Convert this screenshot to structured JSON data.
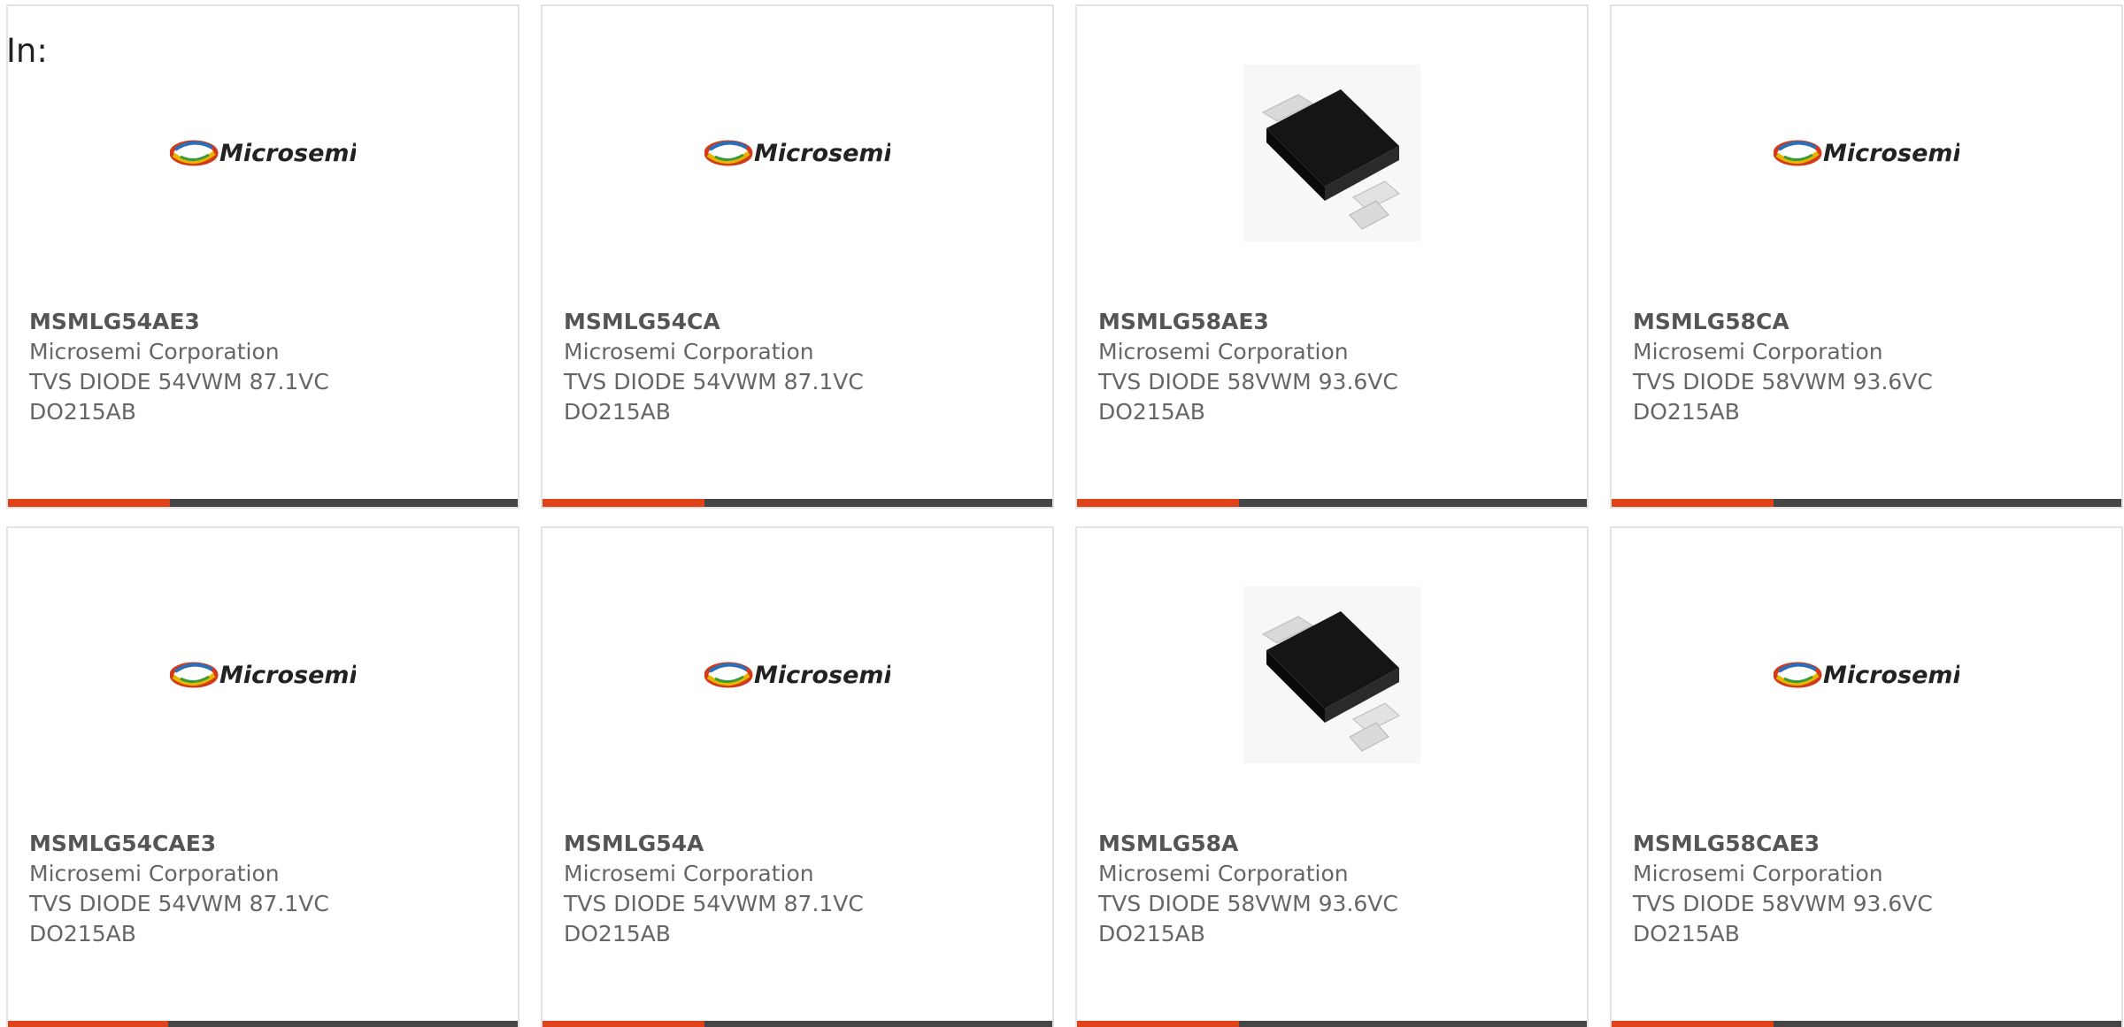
{
  "prefix_label": "In:",
  "colors": {
    "accent": "#e0421a",
    "bar": "#464646",
    "border": "#e3e3e3",
    "text": "#666666"
  },
  "products": [
    {
      "part": "MSMLG54AE3",
      "manufacturer": "Microsemi Corporation",
      "description": "TVS DIODE 54VWM 87.1VC",
      "package": "DO215AB",
      "image": "microsemi-logo",
      "brand_text": "Microsemi"
    },
    {
      "part": "MSMLG54CA",
      "manufacturer": "Microsemi Corporation",
      "description": "TVS DIODE 54VWM 87.1VC",
      "package": "DO215AB",
      "image": "microsemi-logo",
      "brand_text": "Microsemi"
    },
    {
      "part": "MSMLG58AE3",
      "manufacturer": "Microsemi Corporation",
      "description": "TVS DIODE 58VWM 93.6VC",
      "package": "DO215AB",
      "image": "diode-package-photo",
      "brand_text": ""
    },
    {
      "part": "MSMLG58CA",
      "manufacturer": "Microsemi Corporation",
      "description": "TVS DIODE 58VWM 93.6VC",
      "package": "DO215AB",
      "image": "microsemi-logo",
      "brand_text": "Microsemi"
    },
    {
      "part": "MSMLG54CAE3",
      "manufacturer": "Microsemi Corporation",
      "description": "TVS DIODE 54VWM 87.1VC",
      "package": "DO215AB",
      "image": "microsemi-logo",
      "brand_text": "Microsemi"
    },
    {
      "part": "MSMLG54A",
      "manufacturer": "Microsemi Corporation",
      "description": "TVS DIODE 54VWM 87.1VC",
      "package": "DO215AB",
      "image": "microsemi-logo",
      "brand_text": "Microsemi"
    },
    {
      "part": "MSMLG58A",
      "manufacturer": "Microsemi Corporation",
      "description": "TVS DIODE 58VWM 93.6VC",
      "package": "DO215AB",
      "image": "diode-package-photo",
      "brand_text": ""
    },
    {
      "part": "MSMLG58CAE3",
      "manufacturer": "Microsemi Corporation",
      "description": "TVS DIODE 58VWM 93.6VC",
      "package": "DO215AB",
      "image": "microsemi-logo",
      "brand_text": "Microsemi"
    }
  ]
}
